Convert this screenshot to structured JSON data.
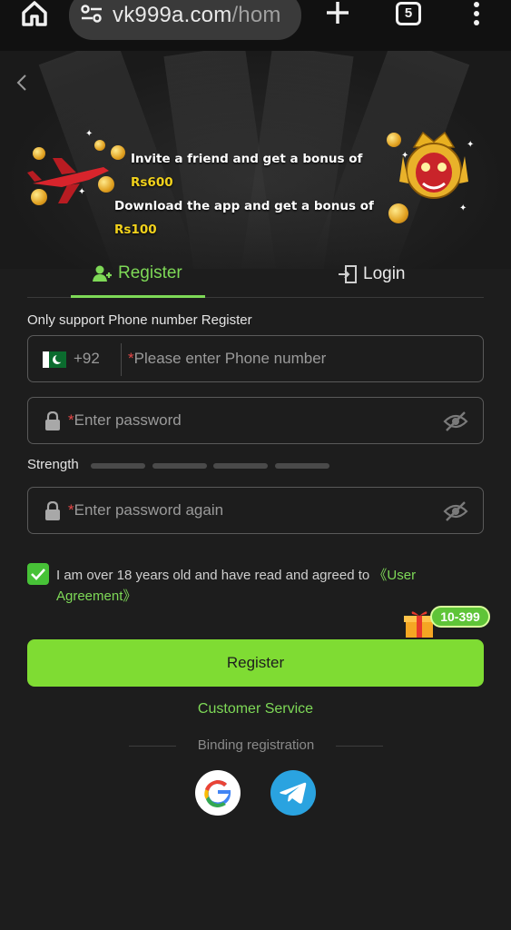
{
  "browser": {
    "url_main": "vk999a.com",
    "url_rest": "/hom",
    "tab_count": "5"
  },
  "banner": {
    "line1_prefix": "Invite a friend and get a bonus of ",
    "line1_amount": "Rs600",
    "line2_prefix": "Download the app and get a bonus of ",
    "line2_amount": "Rs100"
  },
  "tabs": {
    "register": "Register",
    "login": "Login"
  },
  "form": {
    "support_note": "Only support Phone number Register",
    "country_code": "+92",
    "required_mark": "*",
    "phone_placeholder": "Please enter Phone number",
    "password_placeholder": "Enter password",
    "password_again_placeholder": "Enter password again",
    "strength_label": "Strength",
    "agree_text": "I am over 18 years old and have read and agreed to ",
    "agree_link": "《User Agreement》",
    "agree_checked": true,
    "gift_badge": "10-399",
    "register_button": "Register",
    "customer_service": "Customer Service",
    "binding_label": "Binding registration"
  },
  "colors": {
    "accent": "#7ed957",
    "button": "#7fdc33",
    "required": "#e54848",
    "banner_amount": "#f2d21c"
  }
}
